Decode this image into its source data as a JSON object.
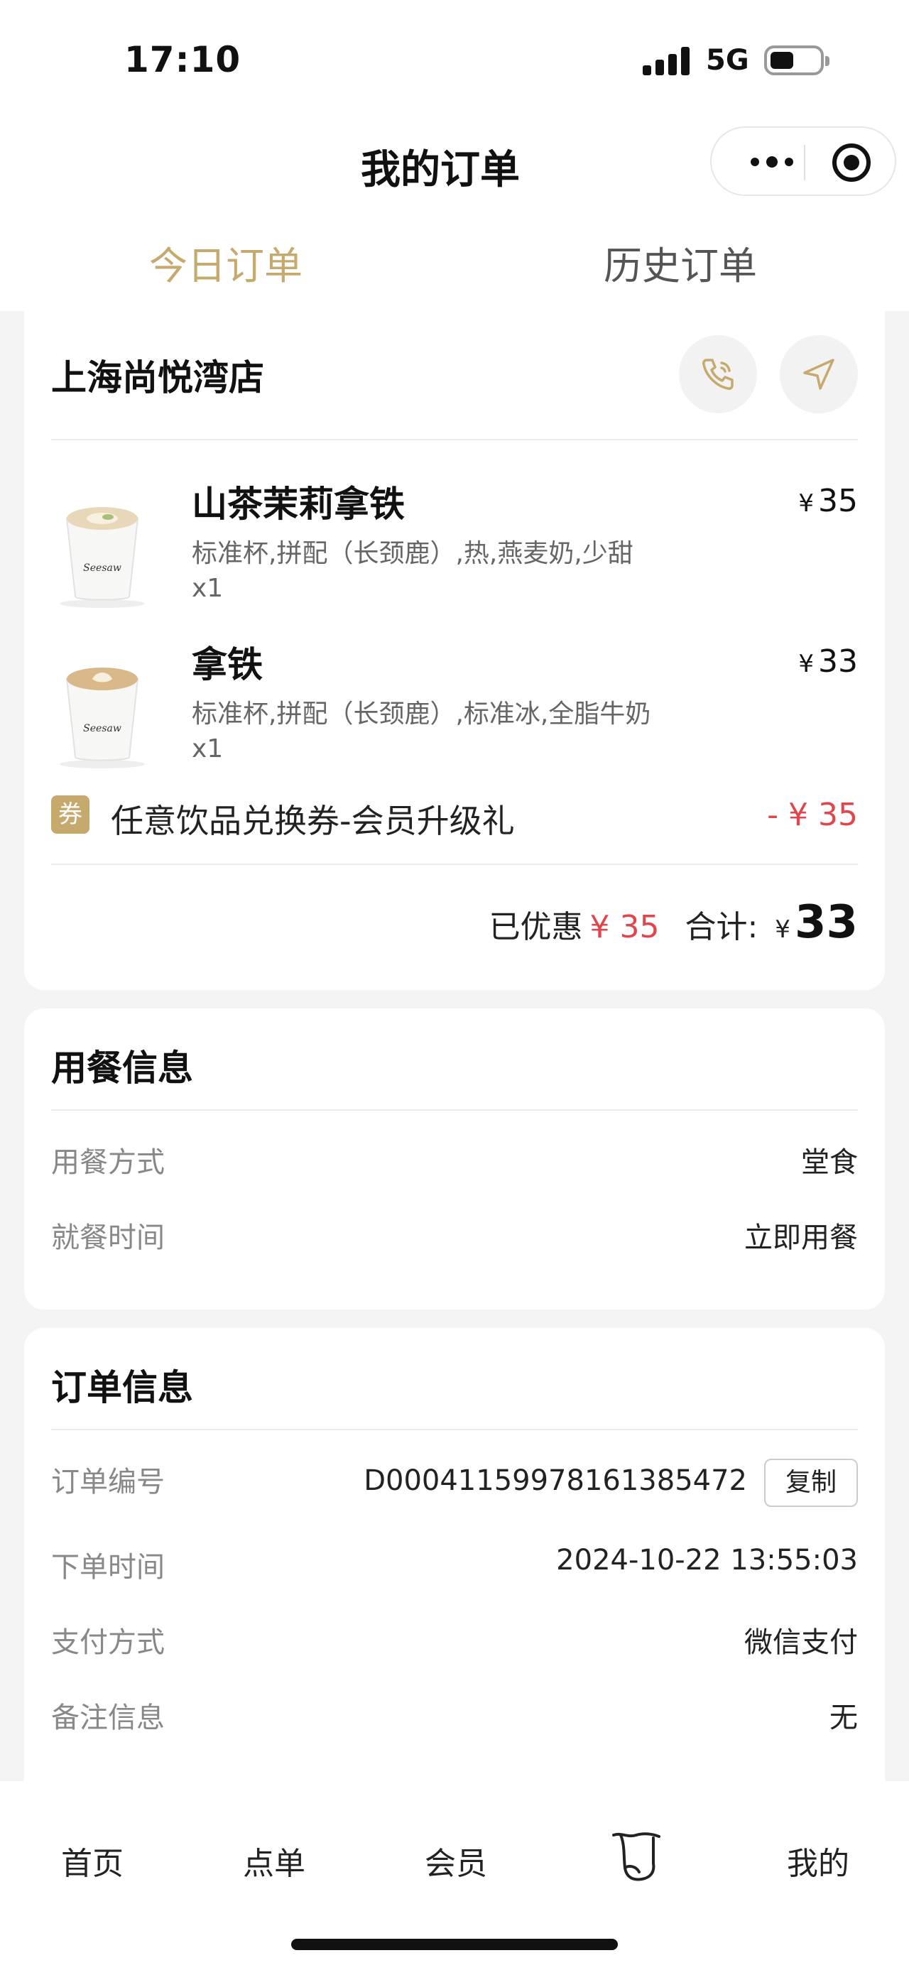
{
  "status_bar": {
    "time": "17:10",
    "network": "5G"
  },
  "nav": {
    "title": "我的订单"
  },
  "tabs": [
    {
      "label": "今日订单"
    },
    {
      "label": "历史订单"
    }
  ],
  "order": {
    "store": "上海尚悦湾店",
    "items": [
      {
        "name": "山茶茉莉拿铁",
        "spec": "标准杯,拼配（长颈鹿）,热,燕麦奶,少甜",
        "qty": "x1",
        "currency": "¥",
        "price": "35"
      },
      {
        "name": "拿铁",
        "spec": "标准杯,拼配（长颈鹿）,标准冰,全脂牛奶",
        "qty": "x1",
        "currency": "¥",
        "price": "33"
      }
    ],
    "coupon": {
      "badge": "券",
      "name": "任意饮品兑换券-会员升级礼",
      "amount": "- ¥ 35"
    },
    "summary": {
      "discount_label": "已优惠",
      "discount": "¥ 35",
      "total_label": "合计:",
      "currency": "¥",
      "total": "33"
    }
  },
  "dining": {
    "title": "用餐信息",
    "rows": [
      {
        "label": "用餐方式",
        "value": "堂食"
      },
      {
        "label": "就餐时间",
        "value": "立即用餐"
      }
    ]
  },
  "order_info": {
    "title": "订单信息",
    "copy_label": "复制",
    "rows": [
      {
        "label": "订单编号",
        "value": "D00041159978161385472"
      },
      {
        "label": "下单时间",
        "value": "2024-10-22 13:55:03"
      },
      {
        "label": "支付方式",
        "value": "微信支付"
      },
      {
        "label": "备注信息",
        "value": "无"
      }
    ]
  },
  "tabbar": [
    {
      "label": "首页"
    },
    {
      "label": "点单"
    },
    {
      "label": "会员"
    },
    {
      "icon": "scroll-icon"
    },
    {
      "label": "我的"
    }
  ],
  "colors": {
    "accent": "#c6a96d",
    "discount": "#e0474c"
  }
}
